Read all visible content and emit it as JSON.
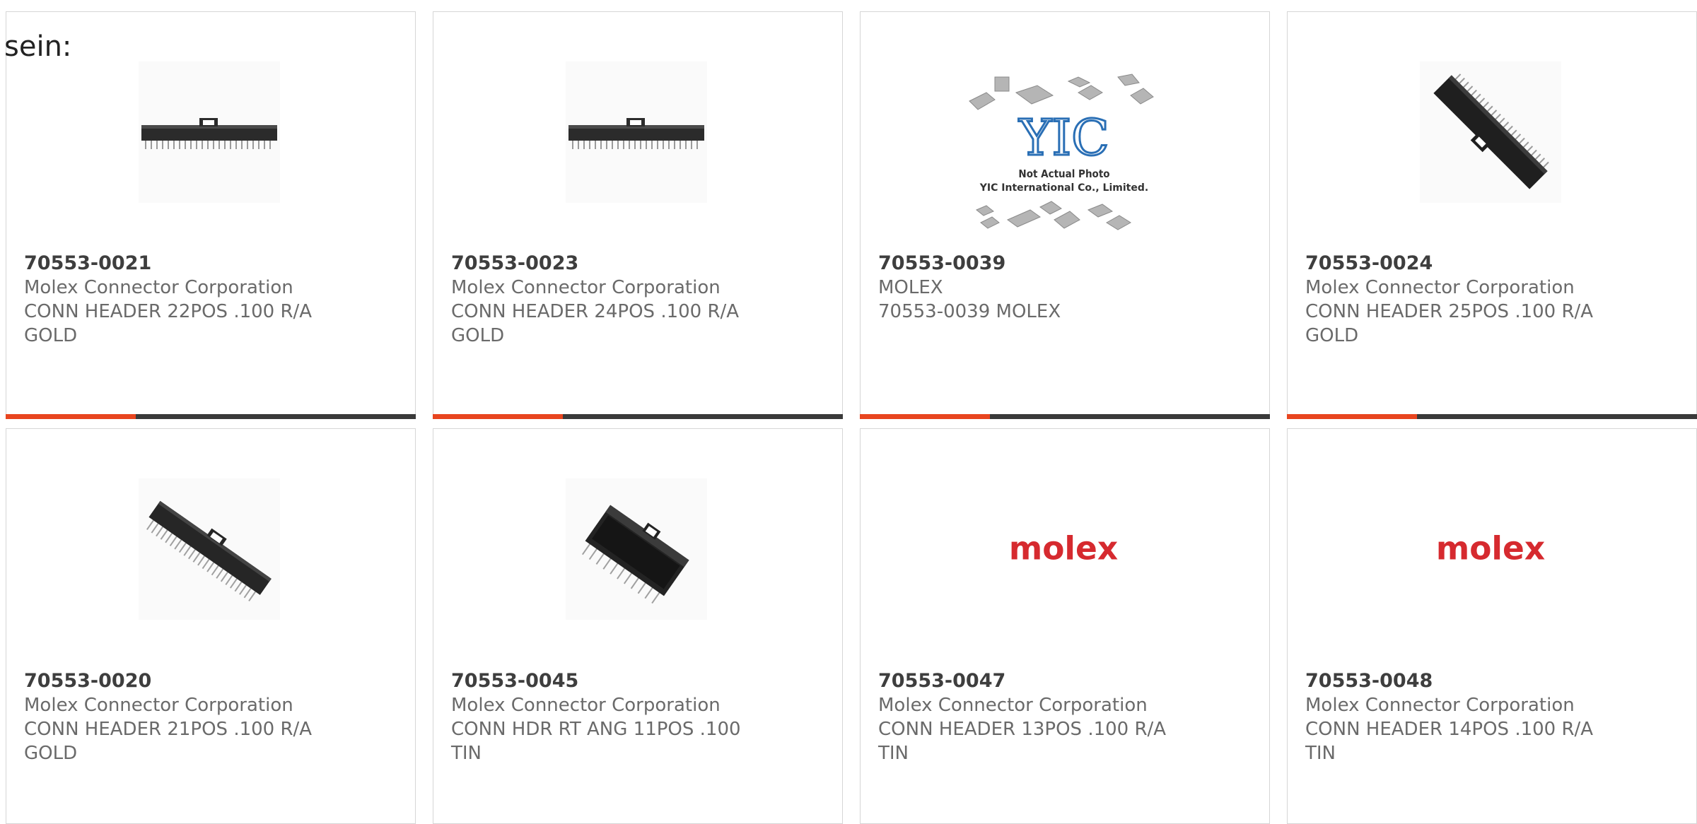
{
  "overlay": {
    "text": "sein:"
  },
  "colors": {
    "accent": "#e8451f",
    "bar": "#3a3a3a",
    "brand_red": "#d62a2f"
  },
  "products": [
    {
      "part": "70553-0021",
      "manufacturer": "Molex Connector Corporation",
      "desc1": "CONN HEADER 22POS .100 R/A",
      "desc2": "GOLD",
      "image": "connector-horizontal"
    },
    {
      "part": "70553-0023",
      "manufacturer": "Molex Connector Corporation",
      "desc1": "CONN HEADER 24POS .100 R/A",
      "desc2": "GOLD",
      "image": "connector-horizontal"
    },
    {
      "part": "70553-0039",
      "manufacturer": "MOLEX",
      "desc1": "70553-0039 MOLEX",
      "desc2": "",
      "image": "placeholder-yic",
      "image_text": {
        "logo": "YIC",
        "line1": "Not Actual Photo",
        "line2": "YIC International Co., Limited."
      }
    },
    {
      "part": "70553-0024",
      "manufacturer": "Molex Connector Corporation",
      "desc1": "CONN HEADER 25POS .100 R/A",
      "desc2": "GOLD",
      "image": "connector-diagonal"
    },
    {
      "part": "70553-0020",
      "manufacturer": "Molex Connector Corporation",
      "desc1": "CONN HEADER 21POS .100 R/A",
      "desc2": "GOLD",
      "image": "connector-diagonal-pins"
    },
    {
      "part": "70553-0045",
      "manufacturer": "Molex Connector Corporation",
      "desc1": "CONN HDR RT ANG 11POS .100",
      "desc2": "TIN",
      "image": "connector-block"
    },
    {
      "part": "70553-0047",
      "manufacturer": "Molex Connector Corporation",
      "desc1": "CONN HEADER 13POS .100 R/A",
      "desc2": "TIN",
      "image": "molex-logo",
      "image_text": {
        "logo": "molex"
      }
    },
    {
      "part": "70553-0048",
      "manufacturer": "Molex Connector Corporation",
      "desc1": "CONN HEADER 14POS .100 R/A",
      "desc2": "TIN",
      "image": "molex-logo",
      "image_text": {
        "logo": "molex"
      }
    }
  ]
}
